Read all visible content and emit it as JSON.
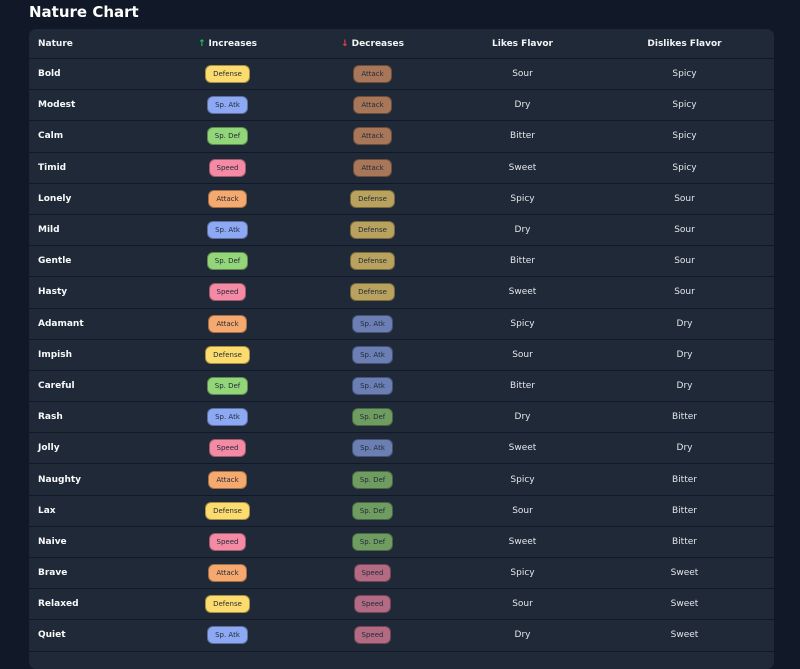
{
  "page": {
    "title": "Nature Chart"
  },
  "table": {
    "headers": {
      "nature": "Nature",
      "increases": "Increases",
      "decreases": "Decreases",
      "likes": "Likes Flavor",
      "dislikes": "Dislikes Flavor",
      "up_arrow": "↑",
      "down_arrow": "↓"
    },
    "stat_colors": {
      "Attack": "#f6a96f",
      "Defense": "#fcdc6e",
      "Sp. Atk": "#8ea9f3",
      "Sp. Def": "#93d579",
      "Speed": "#f58aa5"
    },
    "stat_colors_dim": {
      "Attack": "#a8775a",
      "Defense": "#b9a25e",
      "Sp. Atk": "#6b7fb4",
      "Sp. Def": "#6f9d61",
      "Speed": "#b26b82"
    },
    "rows": [
      {
        "nature": "Bold",
        "inc": "Defense",
        "dec": "Attack",
        "likes": "Sour",
        "dislikes": "Spicy"
      },
      {
        "nature": "Modest",
        "inc": "Sp. Atk",
        "dec": "Attack",
        "likes": "Dry",
        "dislikes": "Spicy"
      },
      {
        "nature": "Calm",
        "inc": "Sp. Def",
        "dec": "Attack",
        "likes": "Bitter",
        "dislikes": "Spicy"
      },
      {
        "nature": "Timid",
        "inc": "Speed",
        "dec": "Attack",
        "likes": "Sweet",
        "dislikes": "Spicy"
      },
      {
        "nature": "Lonely",
        "inc": "Attack",
        "dec": "Defense",
        "likes": "Spicy",
        "dislikes": "Sour"
      },
      {
        "nature": "Mild",
        "inc": "Sp. Atk",
        "dec": "Defense",
        "likes": "Dry",
        "dislikes": "Sour"
      },
      {
        "nature": "Gentle",
        "inc": "Sp. Def",
        "dec": "Defense",
        "likes": "Bitter",
        "dislikes": "Sour"
      },
      {
        "nature": "Hasty",
        "inc": "Speed",
        "dec": "Defense",
        "likes": "Sweet",
        "dislikes": "Sour"
      },
      {
        "nature": "Adamant",
        "inc": "Attack",
        "dec": "Sp. Atk",
        "likes": "Spicy",
        "dislikes": "Dry"
      },
      {
        "nature": "Impish",
        "inc": "Defense",
        "dec": "Sp. Atk",
        "likes": "Sour",
        "dislikes": "Dry"
      },
      {
        "nature": "Careful",
        "inc": "Sp. Def",
        "dec": "Sp. Atk",
        "likes": "Bitter",
        "dislikes": "Dry"
      },
      {
        "nature": "Rash",
        "inc": "Sp. Atk",
        "dec": "Sp. Def",
        "likes": "Dry",
        "dislikes": "Bitter"
      },
      {
        "nature": "Jolly",
        "inc": "Speed",
        "dec": "Sp. Atk",
        "likes": "Sweet",
        "dislikes": "Dry"
      },
      {
        "nature": "Naughty",
        "inc": "Attack",
        "dec": "Sp. Def",
        "likes": "Spicy",
        "dislikes": "Bitter"
      },
      {
        "nature": "Lax",
        "inc": "Defense",
        "dec": "Sp. Def",
        "likes": "Sour",
        "dislikes": "Bitter"
      },
      {
        "nature": "Naive",
        "inc": "Speed",
        "dec": "Sp. Def",
        "likes": "Sweet",
        "dislikes": "Bitter"
      },
      {
        "nature": "Brave",
        "inc": "Attack",
        "dec": "Speed",
        "likes": "Spicy",
        "dislikes": "Sweet"
      },
      {
        "nature": "Relaxed",
        "inc": "Defense",
        "dec": "Speed",
        "likes": "Sour",
        "dislikes": "Sweet"
      },
      {
        "nature": "Quiet",
        "inc": "Sp. Atk",
        "dec": "Speed",
        "likes": "Dry",
        "dislikes": "Sweet"
      }
    ]
  }
}
